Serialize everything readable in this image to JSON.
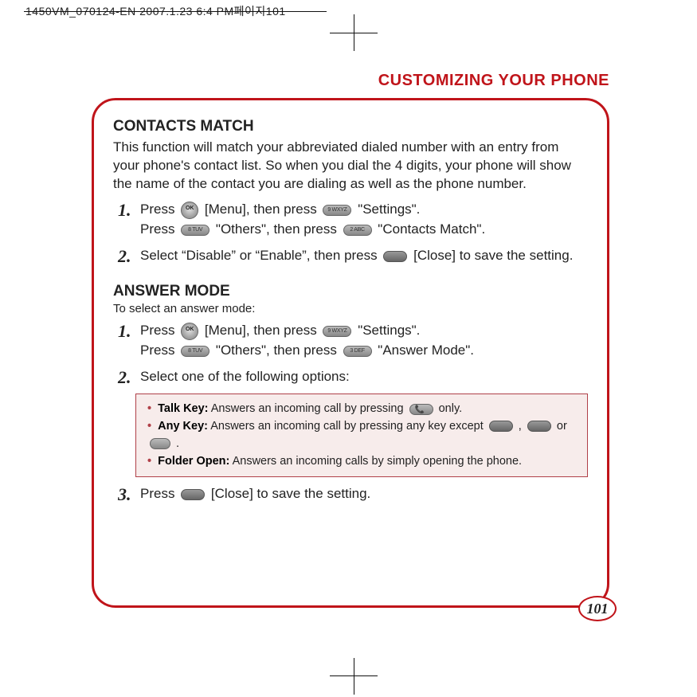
{
  "meta": {
    "crop_header": "1450VM_070124-EN  2007.1.23 6:4 PM페이지101"
  },
  "title": "CUSTOMIZING YOUR PHONE",
  "page_number": "101",
  "sections": {
    "contacts": {
      "heading": "CONTACTS MATCH",
      "intro": "This function will match your abbreviated dialed number with an entry from your phone's contact list.  So when you dial the 4 digits, your phone will show the name of the contact you are dialing as well as the phone number.",
      "step1a_pre": "Press ",
      "step1a_menu": " [Menu], then press ",
      "step1a_settings": " \"Settings\".",
      "step1b_pre": "Press ",
      "step1b_others": " \"Others\", then press ",
      "step1b_end": " \"Contacts Match\".",
      "step2_pre": "Select “Disable” or “Enable”, then press ",
      "step2_end": " [Close] to save the setting."
    },
    "answer": {
      "heading": "ANSWER MODE",
      "sub": "To select an answer mode:",
      "step1a_pre": "Press ",
      "step1a_menu": " [Menu], then press ",
      "step1a_settings": " \"Settings\".",
      "step1b_pre": "Press ",
      "step1b_others": " \"Others\", then press ",
      "step1b_end": " \"Answer Mode\".",
      "step2": "Select one of the following options:",
      "box": {
        "talk_label": "Talk Key:",
        "talk_text_pre": " Answers an incoming call by pressing ",
        "talk_text_post": " only.",
        "any_label": "Any Key:",
        "any_text_pre": " Answers an incoming call by pressing any key except ",
        "any_comma": " ,  ",
        "any_or": " or ",
        "any_end": " .",
        "folder_label": "Folder Open:",
        "folder_text": " Answers an incoming calls by simply opening the phone."
      },
      "step3_pre": "Press ",
      "step3_end": " [Close] to save the setting."
    }
  },
  "nums": {
    "n1": "1.",
    "n2": "2.",
    "n3": "3."
  },
  "keylabels": {
    "k9": "9 WXYZ",
    "k8": "8 TUV",
    "k2": "2 ABC",
    "k3": "3 DEF"
  }
}
